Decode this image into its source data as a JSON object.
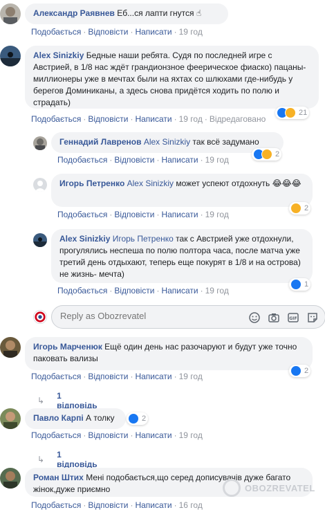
{
  "actions": {
    "like": "Подобається",
    "reply": "Відповісти",
    "write": "Написати",
    "edited": "Відредаговано"
  },
  "comments": [
    {
      "author": "Александр Раявнев",
      "text": "Еб...ся лапти гнутся ☝",
      "time": "19 год"
    },
    {
      "author": "Alex Sinizkiy",
      "text": "Бедные наши ребята. Судя по последней игре с Австрией, в 1/8 нас ждёт грандионзное феерическое фиаско) пацаны- миллионеры уже в мечтах были на яхтах со шлюхами где-нибудь у берегов Доминиканы, а здесь снова придётся ходить по полю и страдать)",
      "time": "19 год",
      "reaction_count": "21"
    },
    {
      "author": "Геннадий Лавренов",
      "mention": "Alex Sinizkiy",
      "text": "так всё задумано",
      "time": "19 год",
      "reaction_count": "2"
    },
    {
      "author": "Игорь Петренко",
      "mention": "Alex Sinizkiy",
      "text": "может успеют отдохнуть 😂😂😂",
      "time": "19 год",
      "reaction_count": "2"
    },
    {
      "author": "Alex Sinizkiy",
      "mention": "Игорь Петренко",
      "text": "так с Австрией уже отдохнули, прогулялись неспеша по полю полтора часа, после матча уже третий день отдыхают, теперь еще покурят в 1/8 и на острова) не жизнь- мечта)",
      "time": "19 год",
      "reaction_count": "1"
    },
    {
      "author": "Игорь Марченюк",
      "text": "Ещё один день нас разочаруют и будут уже точно паковать вализы",
      "time": "19 год",
      "reaction_count": "2",
      "replies": "1 відповідь"
    },
    {
      "author": "Павло Карпі",
      "text": "А толку",
      "time": "19 год",
      "reaction_count": "2",
      "replies": "1 відповідь"
    },
    {
      "author": "Роман Штих",
      "text": "Мені подобається,що серед дописувачів дуже багато жінок,дуже приємно",
      "time": "16 год"
    }
  ],
  "reply_box": {
    "placeholder": "Reply as Obozrevatel"
  },
  "watermark": "OBOZREVATEL",
  "colors": {
    "link": "#385898",
    "bubble": "#f2f3f5",
    "meta": "#90949c",
    "like": "#1877f2",
    "haha": "#f7b125"
  }
}
